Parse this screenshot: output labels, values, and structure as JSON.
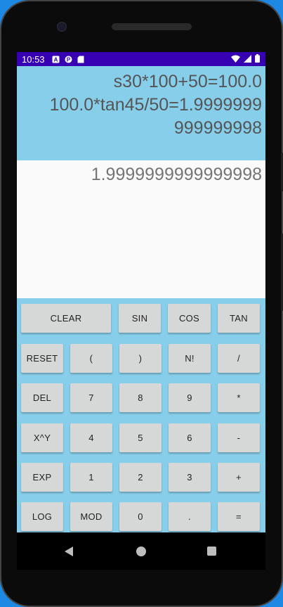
{
  "status_bar": {
    "time": "10:53",
    "icons": [
      "a-notification-icon",
      "p-notification-icon",
      "sd-card-icon"
    ],
    "right_icons": [
      "wifi-icon",
      "signal-icon",
      "battery-icon"
    ]
  },
  "history": {
    "lines": [
      "s30*100+50=100.0",
      "100.0*tan45/50=1.9999999",
      "999999998"
    ]
  },
  "result": {
    "value": "1.9999999999999998"
  },
  "keypad": {
    "clear": "CLEAR",
    "sin": "SIN",
    "cos": "COS",
    "tan": "TAN",
    "reset": "RESET",
    "open_paren": "(",
    "close_paren": ")",
    "factorial": "N!",
    "divide": "/",
    "del": "DEL",
    "seven": "7",
    "eight": "8",
    "nine": "9",
    "multiply": "*",
    "power": "X^Y",
    "four": "4",
    "five": "5",
    "six": "6",
    "minus": "-",
    "exp": "EXP",
    "one": "1",
    "two": "2",
    "three": "3",
    "plus": "+",
    "log": "LOG",
    "mod": "MOD",
    "zero": "0",
    "dot": ".",
    "equals": "="
  },
  "colors": {
    "status_bar": "#3700b3",
    "history_bg": "#87ceeb",
    "result_bg": "#fafafa",
    "key_bg": "#d6d7d7",
    "outer_bg": "#1e88e5"
  }
}
